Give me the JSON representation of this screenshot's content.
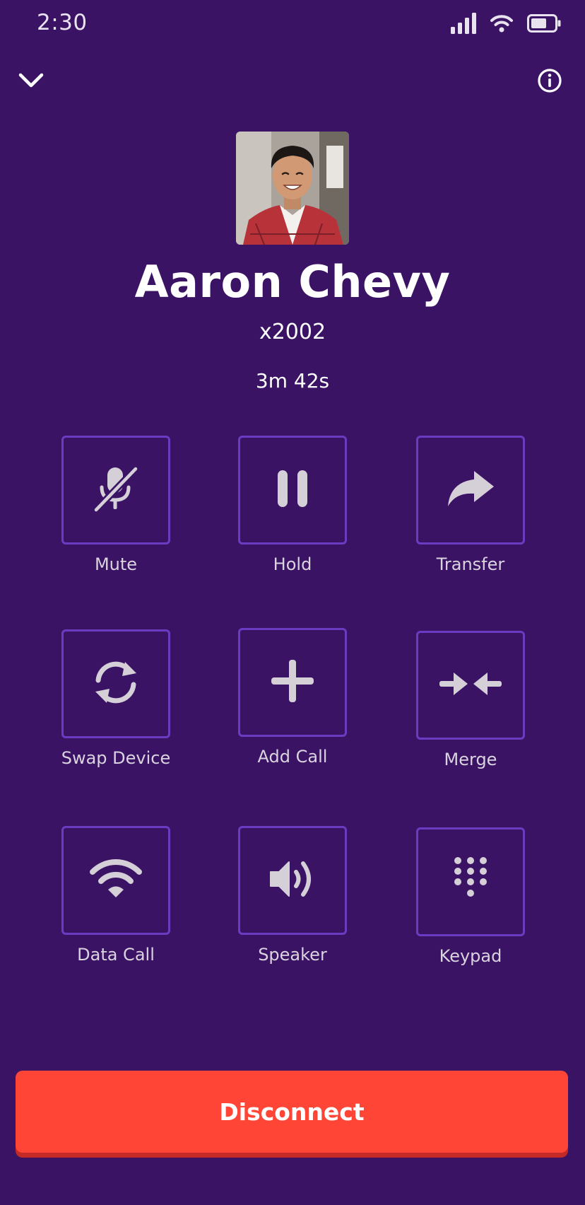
{
  "status_bar": {
    "time": "2:30",
    "icons": [
      "cellular-signal-icon",
      "wifi-icon",
      "battery-icon"
    ]
  },
  "header": {
    "collapse_icon": "chevron-down-icon",
    "info_icon": "info-icon"
  },
  "caller": {
    "name": "Aaron Chevy",
    "extension": "x2002",
    "duration": "3m 42s"
  },
  "controls": [
    {
      "label": "Mute",
      "icon": "microphone-muted-icon"
    },
    {
      "label": "Hold",
      "icon": "pause-icon"
    },
    {
      "label": "Transfer",
      "icon": "share-arrow-icon"
    },
    {
      "label": "Swap Device",
      "icon": "sync-icon"
    },
    {
      "label": "Add Call",
      "icon": "plus-icon"
    },
    {
      "label": "Merge",
      "icon": "merge-arrows-icon"
    },
    {
      "label": "Data Call",
      "icon": "wifi-icon"
    },
    {
      "label": "Speaker",
      "icon": "speaker-icon"
    },
    {
      "label": "Keypad",
      "icon": "dialpad-icon"
    }
  ],
  "disconnect": {
    "label": "Disconnect"
  },
  "colors": {
    "background": "#3b1364",
    "button_border": "#6a3cc2",
    "icon": "#d5d0d8",
    "disconnect": "#ff4535",
    "disconnect_shadow": "#c42a26"
  }
}
